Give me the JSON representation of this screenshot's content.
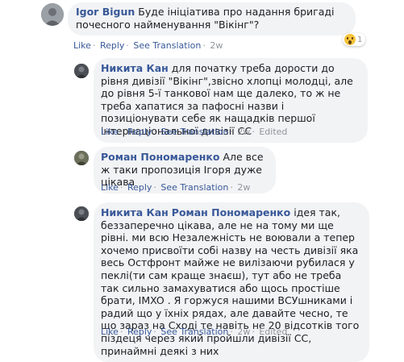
{
  "comments": [
    {
      "author": "Igor Bigun",
      "text": "Буде ініціатива про надання бригаді почесного найменування \"Вікінг\"?",
      "actions": [
        "Like",
        "Reply",
        "See Translation",
        "2w"
      ],
      "reaction": {
        "icon": "wow-icon",
        "count": "1"
      }
    },
    {
      "author": "Никита Кан",
      "text": "для початку треба дорости до рівня дивізії \"Вікінг\",звісно хлопці молодці, але до рівня 5-ї танкової нам ще далеко, то ж не треба хапатися за пафосні назви і позиціонувати себе як нащадків першої інтернаціональної дивізії СС",
      "actions": [
        "Like",
        "Reply",
        "See Translation",
        "2w",
        "Edited"
      ]
    },
    {
      "author": "Роман Пономаренко",
      "text": "Але все ж таки пропозиція Ігоря дуже цікава",
      "actions": [
        "Like",
        "Reply",
        "See Translation",
        "2w"
      ]
    },
    {
      "author": "Никита Кан",
      "mention": "Роман Пономаренко",
      "text": "ідея так, беззаперечно цікава, але не на тому ми ще рівні. ми всю Незалежність не воювали а тепер хочемо присвоїти собі назву на честь дивізії яка весь Остфронт майже не вилізаючи рубилася у пеклі(ти сам краще знаєш), тут або не треба так сильно замахуватися або щось простіше брати, IMXO . Я горжуся нашими ВСУшниками і радий що у їхніх рядах, але давайте чесно, те що зараз на Сході те навіть не 20 відсотків того піздеця через який пройшли дивізії СС, принаймні деякі з них",
      "actions": [
        "Like",
        "Reply",
        "See Translation",
        "2w",
        "Edited"
      ]
    }
  ]
}
